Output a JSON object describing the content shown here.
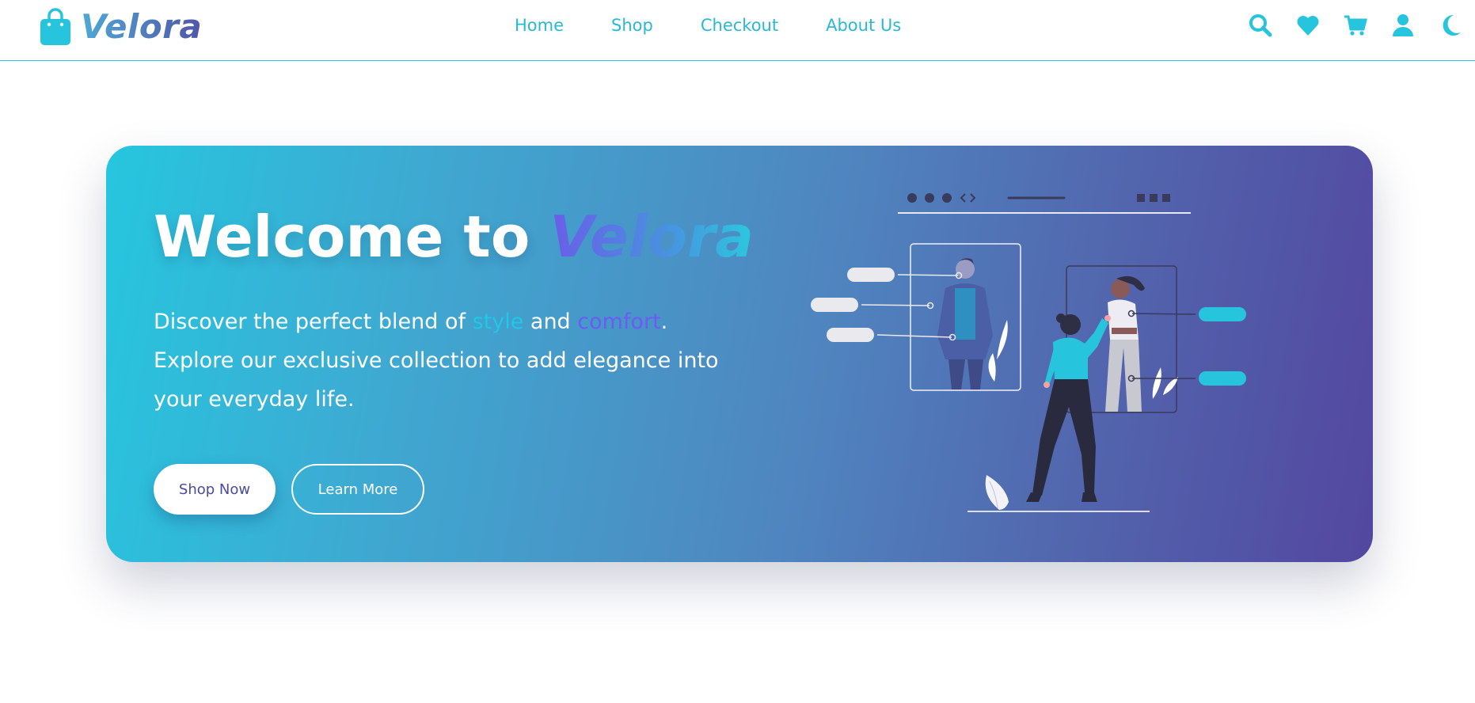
{
  "brand": {
    "name": "Velora",
    "icon": "shopping-bag-icon"
  },
  "nav": {
    "links": [
      {
        "label": "Home"
      },
      {
        "label": "Shop"
      },
      {
        "label": "Checkout"
      },
      {
        "label": "About Us"
      }
    ],
    "icons": [
      {
        "name": "search-icon"
      },
      {
        "name": "heart-icon"
      },
      {
        "name": "cart-icon"
      },
      {
        "name": "user-icon"
      },
      {
        "name": "moon-icon"
      }
    ]
  },
  "hero": {
    "title_prefix": "Welcome to ",
    "title_brand": "Velora",
    "text_part1": "Discover the perfect blend of ",
    "text_style": "style",
    "text_and": " and ",
    "text_comfort": "comfort",
    "text_part2": ". Explore our exclusive collection to add elegance into your everyday life.",
    "primary_button": "Shop Now",
    "secondary_button": "Learn More",
    "illustration": "fashion-shopping-illustration"
  },
  "colors": {
    "accent": "#27c4de",
    "gradient_start": "#26c6df",
    "gradient_end": "#5347a0",
    "brand_dark": "#4a4a9e"
  }
}
